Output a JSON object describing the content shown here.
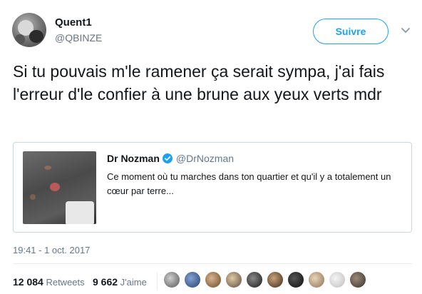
{
  "author": {
    "display_name": "Quent1",
    "handle": "@QBINZE",
    "avatar_icon": "user-avatar"
  },
  "follow_button": {
    "label": "Suivre",
    "color": "#1da1f2"
  },
  "menu": {
    "icon": "chevron-down-icon"
  },
  "tweet": {
    "text": "Si tu pouvais m'le ramener ça serait sympa, j'ai fais l'erreur d'le confier à une brune aux yeux verts mdr",
    "timestamp": "19:41 - 1 oct. 2017"
  },
  "quoted_tweet": {
    "author_name": "Dr Nozman",
    "verified": true,
    "handle": "@DrNozman",
    "text": "Ce moment où tu marches dans ton quartier et qu'il y a totalement un cœur par terre..."
  },
  "stats": {
    "retweets_count": "12 084",
    "retweets_label": "Retweets",
    "likes_count": "9 662",
    "likes_label": "J'aime"
  },
  "likers": [
    "avatar-1",
    "avatar-2",
    "avatar-3",
    "avatar-4",
    "avatar-5",
    "avatar-6",
    "avatar-7",
    "avatar-8",
    "avatar-9",
    "avatar-10"
  ]
}
